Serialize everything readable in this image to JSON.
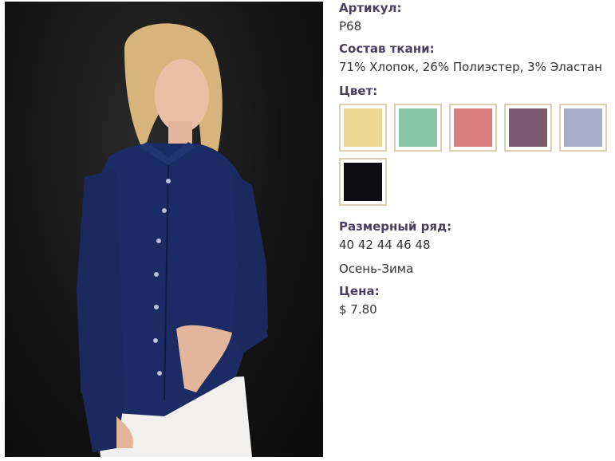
{
  "product": {
    "article_label": "Артикул:",
    "article_value": "P68",
    "fabric_label": "Состав ткани:",
    "fabric_value": "71% Хлопок, 26% Полиэстер, 3% Эластан",
    "color_label": "Цвет:",
    "colors": [
      {
        "name": "yellow-swatch",
        "hex": "#ecd790"
      },
      {
        "name": "mint-swatch",
        "hex": "#89c6a6"
      },
      {
        "name": "coral-swatch",
        "hex": "#d87e7e"
      },
      {
        "name": "plum-swatch",
        "hex": "#7b5b6f"
      },
      {
        "name": "lavender-swatch",
        "hex": "#a7adc8"
      },
      {
        "name": "black-swatch",
        "hex": "#0d0d12"
      }
    ],
    "sizes_label": "Размерный ряд:",
    "sizes_value": "40 42 44 46 48",
    "season_value": "Осень-Зима",
    "price_label": "Цена:",
    "price_value": "$ 7.80"
  }
}
